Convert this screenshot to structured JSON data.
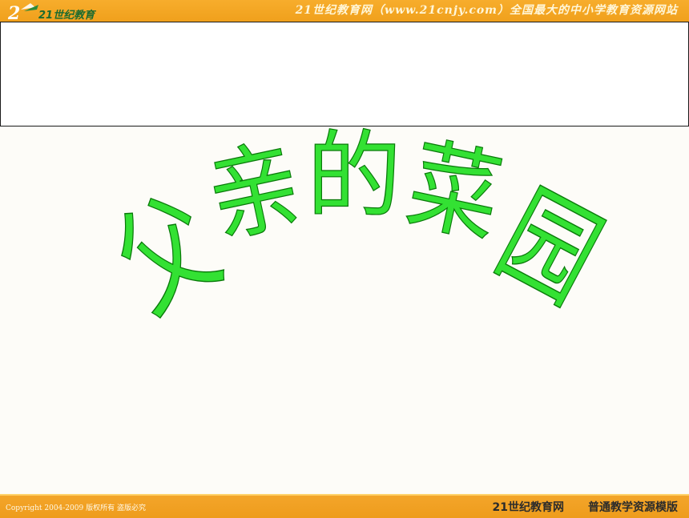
{
  "header": {
    "logo_text": "21世纪教育",
    "site_text": "21世纪教育网（www.21cnjy.com）全国最大的中小学教育资源网站"
  },
  "title": {
    "chars": [
      "父",
      "亲",
      "的",
      "菜",
      "园"
    ],
    "color": "#33e133",
    "stroke_color": "#0a7a0a"
  },
  "footer": {
    "copyright": "Copyright 2004-2009 版权所有 盗版必究",
    "brand": "21世纪教育网",
    "template": "普通教学资源模版"
  },
  "colors": {
    "bar": "#f0a01c",
    "background": "#fdfcf8"
  }
}
